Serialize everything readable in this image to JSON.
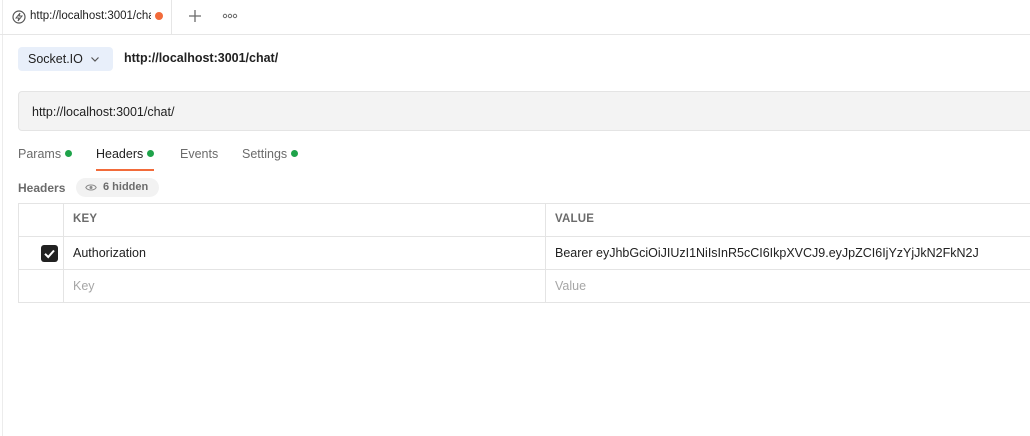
{
  "tab": {
    "title": "http://localhost:3001/chat/",
    "icon": "socket-io-icon",
    "unsaved_color": "#F26B3A"
  },
  "request": {
    "protocol": "Socket.IO",
    "name": "http://localhost:3001/chat/",
    "url": "http://localhost:3001/chat/"
  },
  "subtabs": [
    {
      "label": "Params",
      "has_indicator": true
    },
    {
      "label": "Headers",
      "has_indicator": true,
      "active": true
    },
    {
      "label": "Events",
      "has_indicator": false
    },
    {
      "label": "Settings",
      "has_indicator": true
    }
  ],
  "headers_section": {
    "label": "Headers",
    "hidden_count": "6 hidden"
  },
  "table": {
    "columns": [
      "KEY",
      "VALUE"
    ],
    "rows": [
      {
        "checked": true,
        "key": "Authorization",
        "value": "Bearer eyJhbGciOiJIUzI1NiIsInR5cCI6IkpXVCJ9.eyJpZCI6IjYzYjJkN2FkN2J"
      }
    ],
    "placeholder": {
      "key": "Key",
      "value": "Value"
    }
  },
  "colors": {
    "accent": "#F26B3A",
    "indicator": "#1EA34A",
    "protocol_bg": "#E8EFFA"
  }
}
